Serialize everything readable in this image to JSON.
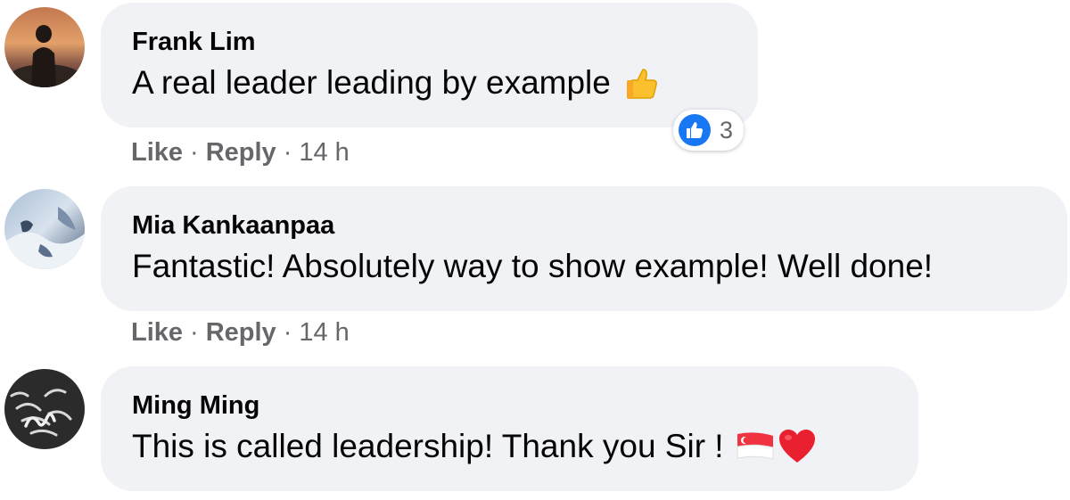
{
  "comments": [
    {
      "author": "Frank Lim",
      "text": "A real leader leading by example",
      "emoji": "thumbs-up-emoji",
      "reactions": {
        "icon": "like-reaction-icon",
        "count": "3"
      },
      "actions": {
        "like": "Like",
        "reply": "Reply",
        "time": "14 h"
      }
    },
    {
      "author": "Mia Kankaanpaa",
      "text": "Fantastic! Absolutely way to show example! Well done!",
      "actions": {
        "like": "Like",
        "reply": "Reply",
        "time": "14 h"
      }
    },
    {
      "author": "Ming Ming",
      "text": "This is called leadership! Thank you Sir !",
      "emojis": [
        "singapore-flag-emoji",
        "red-heart-emoji"
      ]
    }
  ],
  "separator": "·",
  "colors": {
    "bubble": "#f0f2f5",
    "meta_text": "#65676b",
    "like_blue": "#1877f2"
  }
}
